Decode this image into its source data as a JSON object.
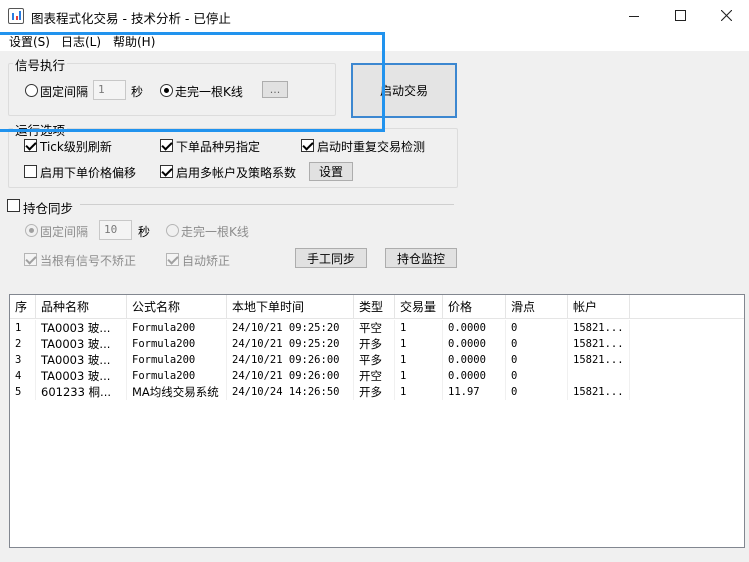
{
  "window": {
    "title": "图表程式化交易 - 技术分析 - 已停止",
    "minimize_icon": "minimize-icon",
    "maximize_icon": "maximize-icon",
    "close_icon": "close-icon"
  },
  "menu": [
    "设置(S)",
    "日志(L)",
    "帮助(H)"
  ],
  "signal_group": {
    "title": "信号执行",
    "fixed_interval_label": "固定间隔",
    "interval_value": "1",
    "seconds_unit": "秒",
    "bar_complete_label": "走完一根K线",
    "dots_button": "...",
    "selected_option": "bar_complete"
  },
  "start_button": "启动交易",
  "run_options": {
    "title": "运行选项",
    "tick_refresh": {
      "label": "Tick级别刷新",
      "checked": true
    },
    "order_symbol": {
      "label": "下单品种另指定",
      "checked": true
    },
    "startup_check": {
      "label": "启动时重复交易检测",
      "checked": true
    },
    "price_offset": {
      "label": "启用下单价格偏移",
      "checked": false
    },
    "multi_account": {
      "label": "启用多帐户及策略系数",
      "checked": true
    },
    "settings_button": "设置"
  },
  "position_sync": {
    "title": "持仓同步",
    "checked": false,
    "fixed_interval_label": "固定间隔",
    "interval_value": "10",
    "seconds_unit": "秒",
    "bar_complete_label": "走完一根K线",
    "no_correct_label": "当根有信号不矫正",
    "auto_correct_label": "自动矫正",
    "manual_sync_button": "手工同步",
    "monitor_button": "持仓监控"
  },
  "table": {
    "columns": [
      "序",
      "品种名称",
      "公式名称",
      "本地下单时间",
      "类型",
      "交易量",
      "价格",
      "滑点",
      "帐户"
    ],
    "rows": [
      [
        "1",
        "TA0003 玻...",
        "Formula200",
        "24/10/21 09:25:20",
        "平空",
        "1",
        "0.0000",
        "0",
        "15821..."
      ],
      [
        "2",
        "TA0003 玻...",
        "Formula200",
        "24/10/21 09:25:20",
        "开多",
        "1",
        "0.0000",
        "0",
        "15821..."
      ],
      [
        "3",
        "TA0003 玻...",
        "Formula200",
        "24/10/21 09:26:00",
        "平多",
        "1",
        "0.0000",
        "0",
        "15821..."
      ],
      [
        "4",
        "TA0003 玻...",
        "Formula200",
        "24/10/21 09:26:00",
        "开空",
        "1",
        "0.0000",
        "0",
        ""
      ],
      [
        "5",
        "601233 桐...",
        "MA均线交易系统",
        "24/10/24 14:26:50",
        "开多",
        "1",
        "11.97",
        "0",
        "15821..."
      ]
    ]
  },
  "colors": {
    "highlight": "#2193ee",
    "start_button_border": "#3c87d0"
  }
}
